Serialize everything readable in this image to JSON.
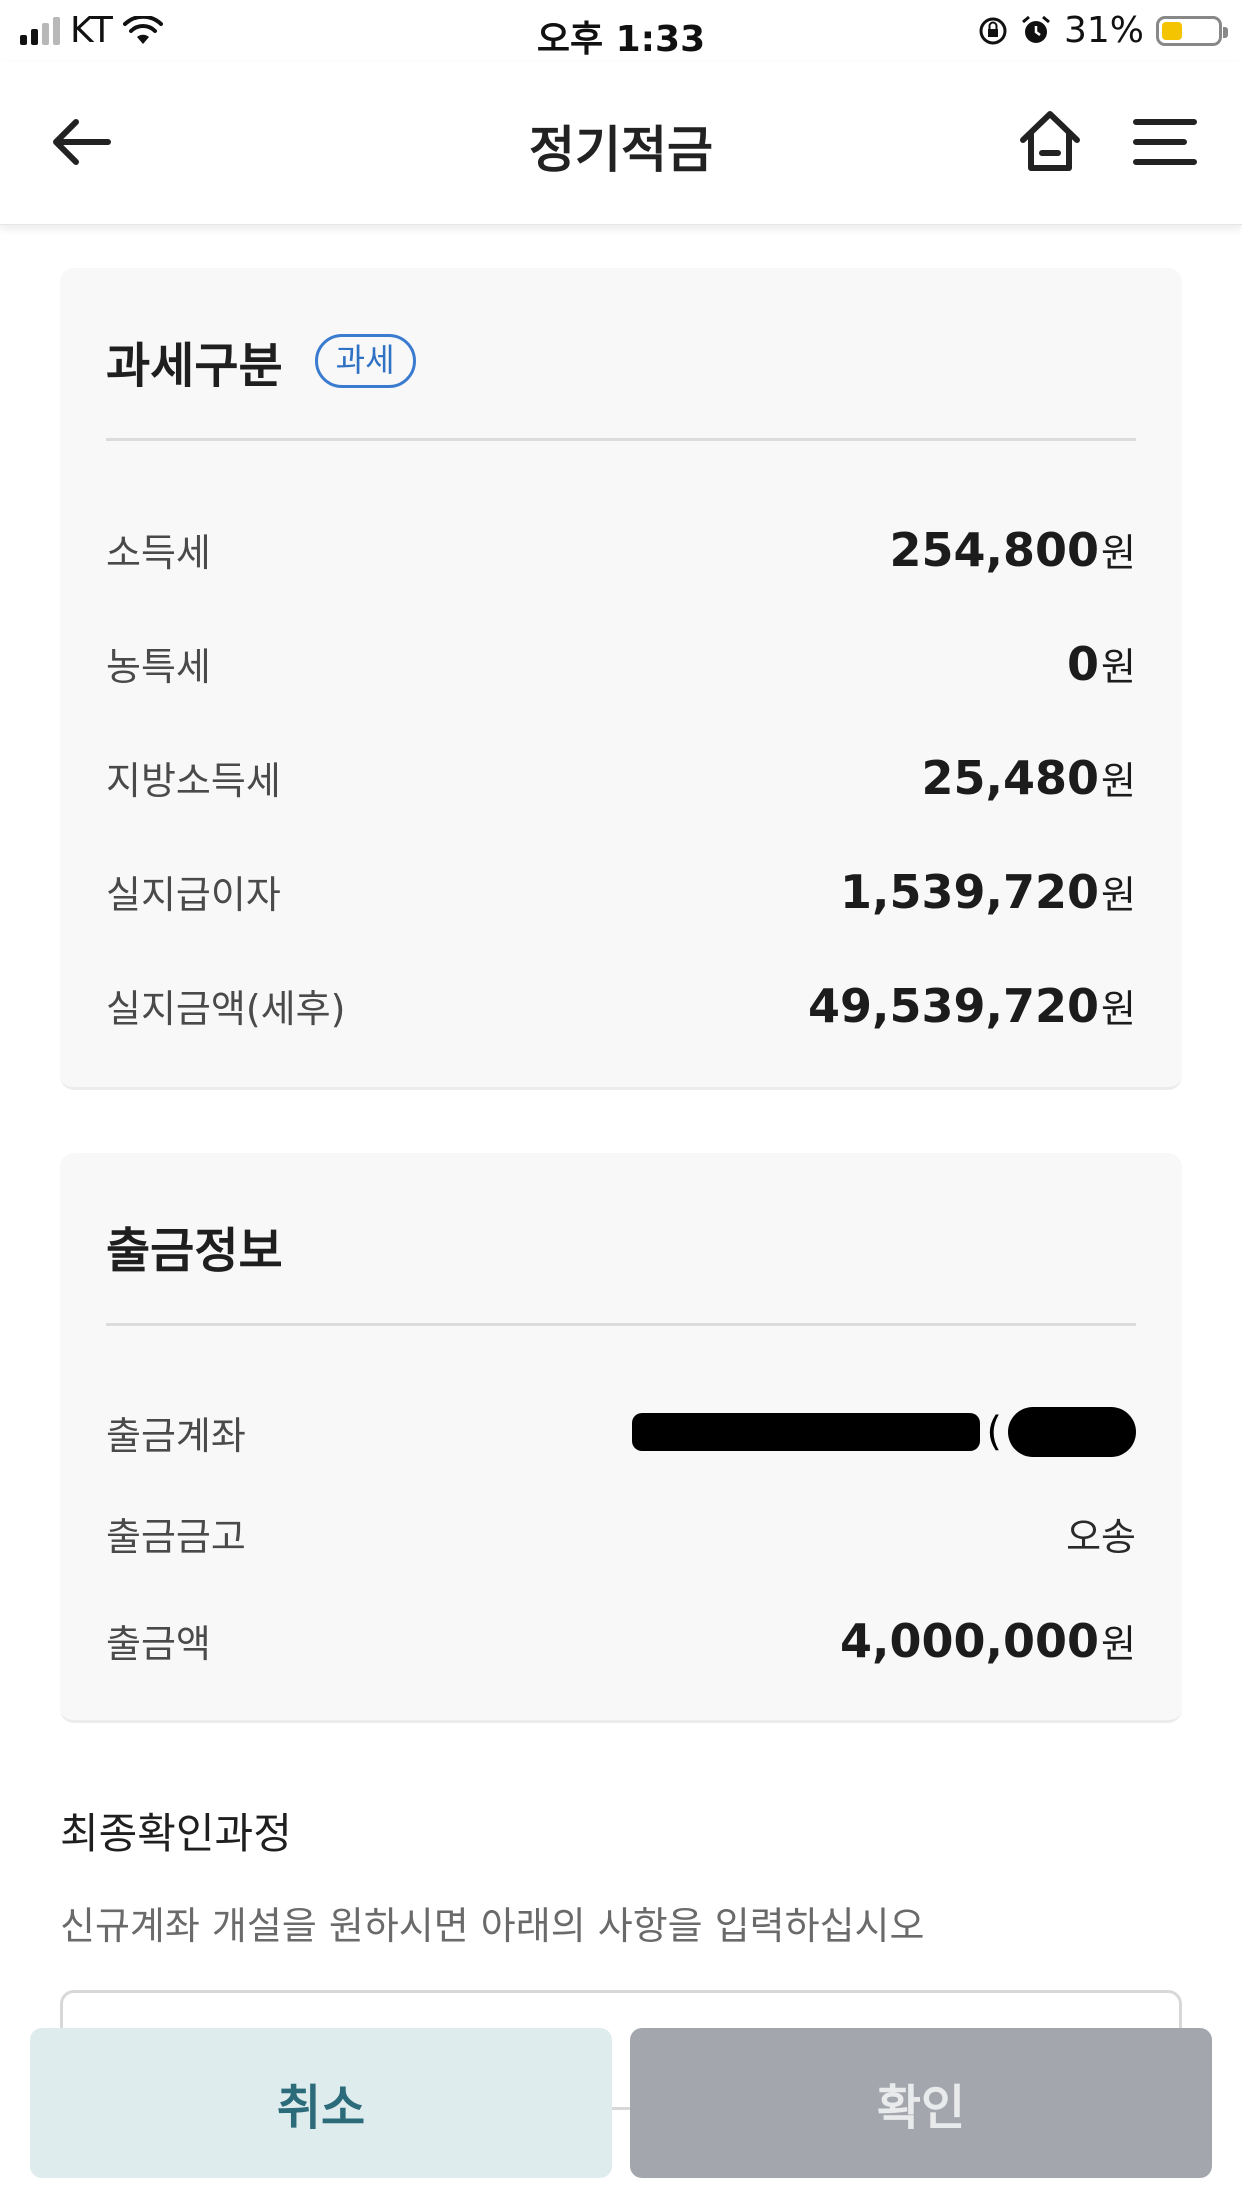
{
  "status_bar": {
    "carrier": "KT",
    "time": "오후 1:33",
    "battery": "31%"
  },
  "header": {
    "title": "정기적금"
  },
  "tax_card": {
    "title": "과세구분",
    "badge": "과세",
    "rows": [
      {
        "label": "소득세",
        "value": "254,800",
        "unit": "원"
      },
      {
        "label": "농특세",
        "value": "0",
        "unit": "원"
      },
      {
        "label": "지방소득세",
        "value": "25,480",
        "unit": "원"
      },
      {
        "label": "실지급이자",
        "value": "1,539,720",
        "unit": "원"
      },
      {
        "label": "실지금액(세후)",
        "value": "49,539,720",
        "unit": "원"
      }
    ]
  },
  "withdraw_card": {
    "title": "출금정보",
    "account_label": "출금계좌",
    "bank_label": "출금금고",
    "bank_value": "오송",
    "amount_label": "출금액",
    "amount_value": "4,000,000",
    "amount_unit": "원"
  },
  "final_check": {
    "title": "최종확인과정",
    "description": "신규계좌 개설을 원하시면 아래의 사항을 입력하십시오"
  },
  "buttons": {
    "cancel": "취소",
    "confirm": "확인"
  }
}
